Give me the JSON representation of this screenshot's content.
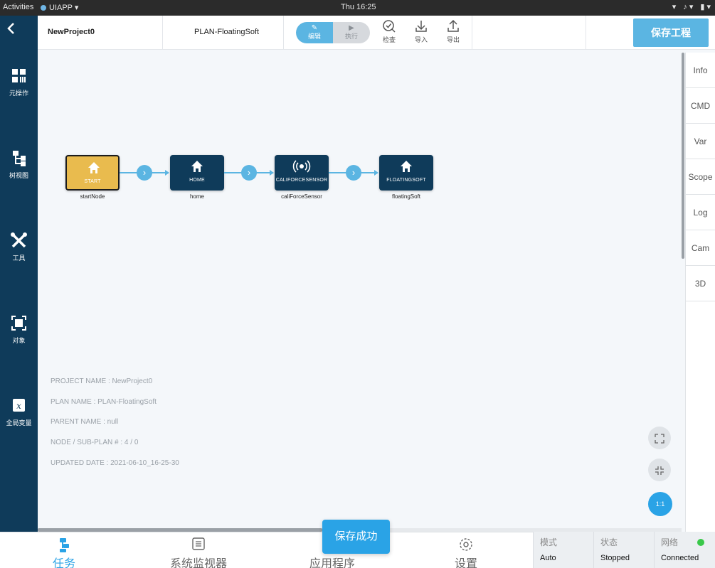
{
  "system_bar": {
    "activities": "Activities",
    "app_name": "UIAPP ▾",
    "clock": "Thu 16:25",
    "tray": [
      "▾",
      "♪ ▾",
      "▮ ▾"
    ]
  },
  "header": {
    "project_name": "NewProject0",
    "plan_name": "PLAN-FloatingSoft",
    "mode_edit": "编辑",
    "mode_run": "执行",
    "tools": [
      {
        "icon": "inspect-icon",
        "label": "检查"
      },
      {
        "icon": "import-icon",
        "label": "导入"
      },
      {
        "icon": "export-icon",
        "label": "导出"
      }
    ],
    "save_label": "保存工程",
    "accent": "#5bb5e2"
  },
  "sidebar": {
    "items": [
      {
        "icon": "meta-operation-icon",
        "label": "元操作"
      },
      {
        "icon": "tree-view-icon",
        "label": "树视图"
      },
      {
        "icon": "tools-icon",
        "label": "工具"
      },
      {
        "icon": "object-icon",
        "label": "对象"
      },
      {
        "icon": "global-variable-icon",
        "label": "全局变量"
      }
    ],
    "color": "#0f3b5a"
  },
  "right_panel": {
    "tabs": [
      "Info",
      "CMD",
      "Var",
      "Scope",
      "Log",
      "Cam",
      "3D"
    ]
  },
  "flow": {
    "nodes": [
      {
        "title": "START",
        "label": "startNode",
        "icon": "home-icon",
        "color": "#e9bb4e"
      },
      {
        "title": "HOME",
        "label": "home",
        "icon": "home-icon",
        "color": "#0f3b5a"
      },
      {
        "title": "CALIFORCESENSOR",
        "label": "caliForceSensor",
        "icon": "sensor-icon",
        "color": "#0f3b5a"
      },
      {
        "title": "FLOATINGSOFT",
        "label": "floatingSoft",
        "icon": "home-icon",
        "color": "#0f3b5a"
      }
    ]
  },
  "info": {
    "project_name": "PROJECT NAME :  NewProject0",
    "plan_name": "PLAN NAME :  PLAN-FloatingSoft",
    "parent_name": "PARENT NAME :  null",
    "node_count": "NODE / SUB-PLAN # :  4 / 0",
    "updated_date": "UPDATED DATE :  2021-06-10_16-25-30"
  },
  "canvas_controls": {
    "fit_label": "⛶",
    "shrink_label": "⇲",
    "reset_label": "1:1"
  },
  "toast": "保存成功",
  "bottom_tabs": [
    {
      "icon": "task-icon",
      "label": "任务",
      "active": true
    },
    {
      "icon": "monitor-icon",
      "label": "系统监视器",
      "active": false
    },
    {
      "icon": "app-icon",
      "label": "应用程序",
      "active": false
    },
    {
      "icon": "settings-icon",
      "label": "设置",
      "active": false
    }
  ],
  "status": {
    "mode_key": "模式",
    "mode_value": "Auto",
    "state_key": "状态",
    "state_value": "Stopped",
    "network_key": "网络",
    "network_value": "Connected",
    "network_color": "#3ac84a"
  }
}
